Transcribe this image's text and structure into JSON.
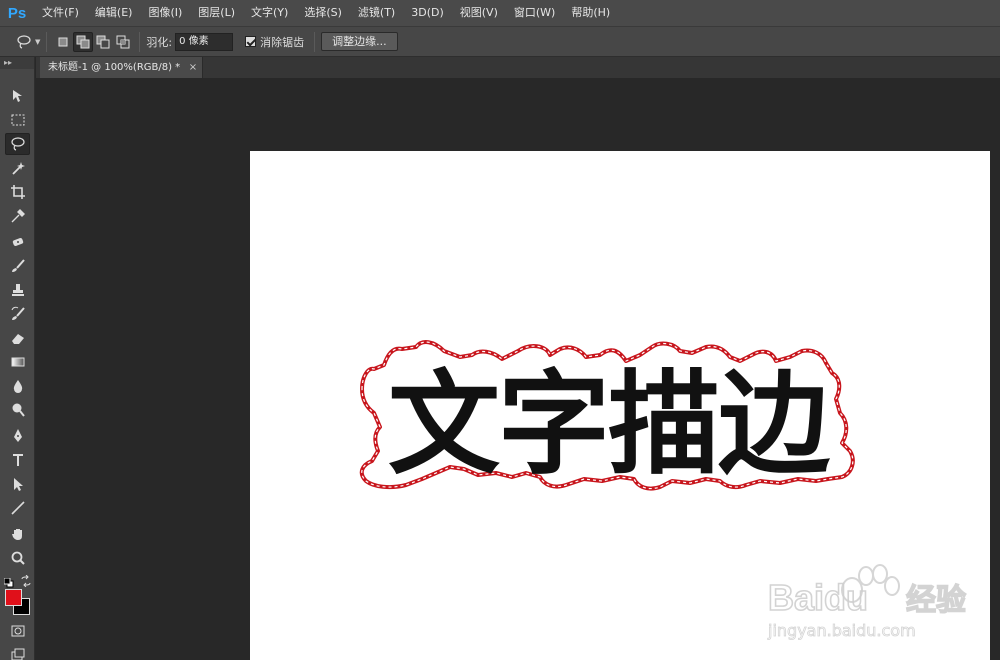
{
  "app": {
    "logo": "Ps"
  },
  "menu": [
    "文件(F)",
    "编辑(E)",
    "图像(I)",
    "图层(L)",
    "文字(Y)",
    "选择(S)",
    "滤镜(T)",
    "3D(D)",
    "视图(V)",
    "窗口(W)",
    "帮助(H)"
  ],
  "options": {
    "feather_label": "羽化:",
    "feather_value": "0 像素",
    "antialias_label": "消除锯齿",
    "antialias_checked": true,
    "refine_edge_label": "调整边缘..."
  },
  "document": {
    "tab_title": "未标题-1 @ 100%(RGB/8) *",
    "close_glyph": "×"
  },
  "canvas": {
    "text": "文字描边",
    "selection_stroke_color": "#c8161d"
  },
  "colors": {
    "foreground": "#e0101a",
    "background": "#000000"
  },
  "watermark": {
    "brand": "Baidu",
    "brand_cn": "经验",
    "url": "jingyan.baidu.com"
  },
  "tools": [
    "move-tool",
    "marquee-tool",
    "lasso-tool",
    "magic-wand-tool",
    "crop-tool",
    "eyedropper-tool",
    "spot-healing-tool",
    "brush-tool",
    "clone-stamp-tool",
    "history-brush-tool",
    "eraser-tool",
    "gradient-tool",
    "blur-tool",
    "dodge-tool",
    "pen-tool",
    "type-tool",
    "path-selection-tool",
    "line-tool",
    "hand-tool",
    "zoom-tool"
  ]
}
